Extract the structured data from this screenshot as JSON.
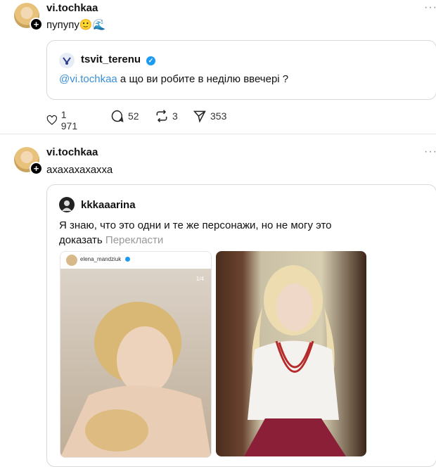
{
  "post1": {
    "username": "vi.tochkaa",
    "text": "пупупу🙂🌊",
    "more_icon": "more-icon",
    "quote": {
      "username": "tsvit_terenu",
      "mention": "@vi.tochkaa",
      "text": " а що ви робите в неділю ввечері ?"
    },
    "actions": {
      "likes": "1 971",
      "comments": "52",
      "reposts": "3",
      "shares": "353"
    }
  },
  "post2": {
    "username": "vi.tochkaa",
    "text": "ахахахахахха",
    "quote": {
      "username": "kkkaaarina",
      "text_line1": "Я знаю, что это одни и те же персонажи, но не могу это",
      "text_line2": "доказать",
      "translate": "Перекласти",
      "left_image": {
        "username": "elena_mandziuk",
        "counter": "1/4"
      }
    }
  },
  "colors": {
    "accent": "#1d9bf0",
    "mention": "#3a8fd9",
    "muted": "#999999"
  }
}
